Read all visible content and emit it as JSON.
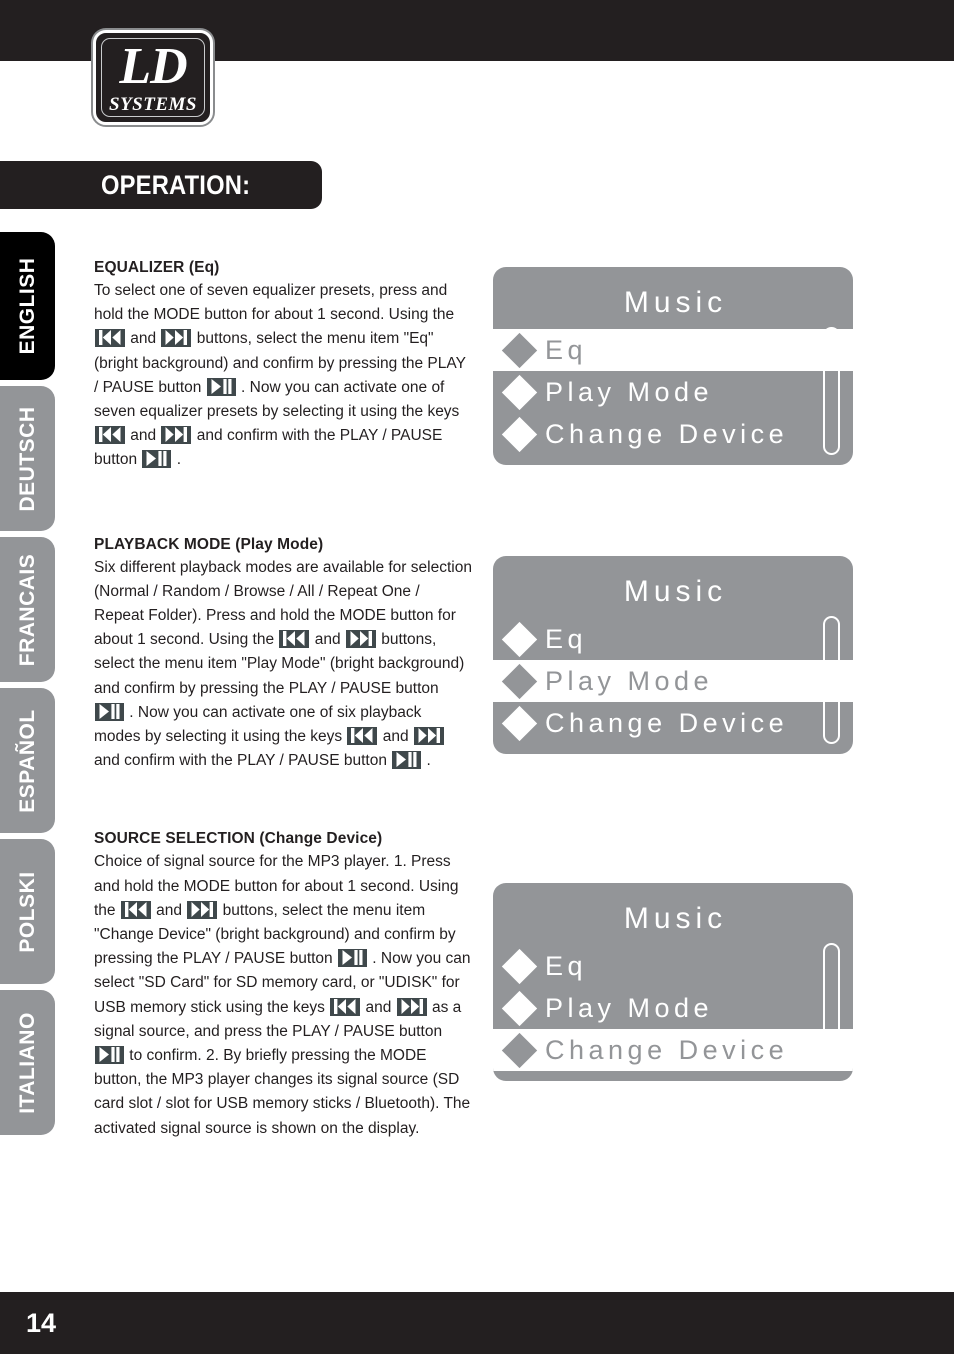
{
  "header": {
    "logo_primary": "LD",
    "logo_secondary": "SYSTEMS",
    "banner_title": "OPERATION:"
  },
  "sidebar": {
    "tabs": [
      {
        "label": "ENGLISH",
        "active": true
      },
      {
        "label": "DEUTSCH",
        "active": false
      },
      {
        "label": "FRANCAIS",
        "active": false
      },
      {
        "label": "ESPAÑOL",
        "active": false
      },
      {
        "label": "POLSKI",
        "active": false
      },
      {
        "label": "ITALIANO",
        "active": false
      }
    ]
  },
  "sections": [
    {
      "title": "EQUALIZER (Eq)",
      "body_parts": [
        {
          "type": "text",
          "value": "To select one of seven equalizer presets, press and hold the MODE button for about 1 second. Using the "
        },
        {
          "type": "icon",
          "value": "prev-track-icon"
        },
        {
          "type": "text",
          "value": " and "
        },
        {
          "type": "icon",
          "value": "next-track-icon"
        },
        {
          "type": "text",
          "value": " buttons, select the menu item \"Eq\" (bright background) and confirm by pressing the PLAY / PAUSE button "
        },
        {
          "type": "icon",
          "value": "play-pause-icon"
        },
        {
          "type": "text",
          "value": " . Now you can activate one of seven equalizer presets by selecting it using the keys "
        },
        {
          "type": "icon",
          "value": "prev-track-icon"
        },
        {
          "type": "text",
          "value": " and "
        },
        {
          "type": "icon",
          "value": "next-track-icon"
        },
        {
          "type": "text",
          "value": " and confirm with the PLAY / PAUSE button "
        },
        {
          "type": "icon",
          "value": "play-pause-icon"
        },
        {
          "type": "text",
          "value": " ."
        }
      ]
    },
    {
      "title": "PLAYBACK MODE (Play Mode)",
      "body_parts": [
        {
          "type": "text",
          "value": "Six different playback modes are available for selection (Normal / Random / Browse / All / Repeat One / Repeat Folder). Press and hold the MODE button for about 1 second. Using the "
        },
        {
          "type": "icon",
          "value": "prev-track-icon"
        },
        {
          "type": "text",
          "value": " and "
        },
        {
          "type": "icon",
          "value": "next-track-icon"
        },
        {
          "type": "text",
          "value": " buttons, select the menu item \"Play Mode\" (bright background) and confirm by pressing the PLAY / PAUSE button "
        },
        {
          "type": "icon",
          "value": "play-pause-icon"
        },
        {
          "type": "text",
          "value": " . Now you can activate one of six playback modes by selecting it using the keys "
        },
        {
          "type": "icon",
          "value": "prev-track-icon"
        },
        {
          "type": "text",
          "value": " and "
        },
        {
          "type": "icon",
          "value": "next-track-icon"
        },
        {
          "type": "text",
          "value": " and confirm with the PLAY / PAUSE button "
        },
        {
          "type": "icon",
          "value": "play-pause-icon"
        },
        {
          "type": "text",
          "value": " ."
        }
      ]
    },
    {
      "title": "SOURCE SELECTION (Change Device)",
      "body_parts": [
        {
          "type": "text",
          "value": "Choice of signal source for the MP3 player. 1. Press and hold the MODE button for about 1 second. Using the "
        },
        {
          "type": "icon",
          "value": "prev-track-icon"
        },
        {
          "type": "text",
          "value": " and "
        },
        {
          "type": "icon",
          "value": "next-track-icon"
        },
        {
          "type": "text",
          "value": " buttons, select the menu item \"Change Device\" (bright background) and confirm by pressing the PLAY / PAUSE button "
        },
        {
          "type": "icon",
          "value": "play-pause-icon"
        },
        {
          "type": "text",
          "value": " . Now you can select \"SD Card\" for SD memory card, or \"UDISK\" for USB memory stick using the keys "
        },
        {
          "type": "icon",
          "value": "prev-track-icon"
        },
        {
          "type": "text",
          "value": " and "
        },
        {
          "type": "icon",
          "value": "next-track-icon"
        },
        {
          "type": "text",
          "value": " as a signal source, and press the PLAY / PAUSE button "
        },
        {
          "type": "icon",
          "value": "play-pause-icon"
        },
        {
          "type": "text",
          "value": " to confirm. 2. By briefly pressing the MODE button, the MP3 player changes its signal source (SD card slot / slot for USB memory sticks / Bluetooth). The activated signal source is shown on the display."
        }
      ]
    }
  ],
  "displays": [
    {
      "title": "Music",
      "rows": [
        {
          "label": "Eq",
          "selected": true
        },
        {
          "label": "Play Mode",
          "selected": false
        },
        {
          "label": "Change Device",
          "selected": false
        }
      ],
      "scroll_position": "top"
    },
    {
      "title": "Music",
      "rows": [
        {
          "label": "Eq",
          "selected": false
        },
        {
          "label": "Play Mode",
          "selected": true
        },
        {
          "label": "Change Device",
          "selected": false
        }
      ],
      "scroll_position": "middle"
    },
    {
      "title": "Music",
      "rows": [
        {
          "label": "Eq",
          "selected": false
        },
        {
          "label": "Play Mode",
          "selected": false
        },
        {
          "label": "Change Device",
          "selected": true
        }
      ],
      "scroll_position": "bottom"
    }
  ],
  "footer": {
    "page_number": "14"
  },
  "colors": {
    "dark": "#231f20",
    "gray": "#939598",
    "key_icon_bg": "#3f484b",
    "white": "#ffffff"
  }
}
